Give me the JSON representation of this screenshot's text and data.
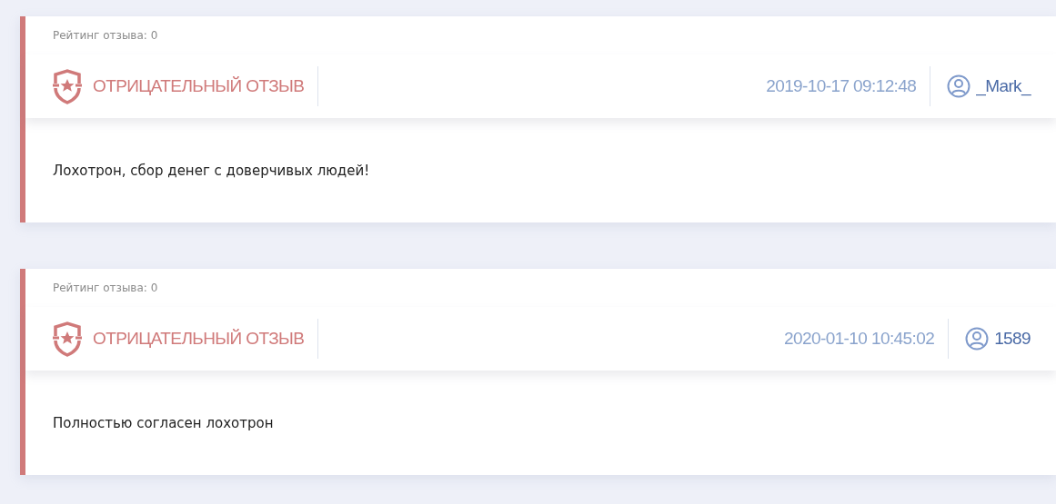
{
  "reviews": [
    {
      "rating_label": "Рейтинг отзыва: 0",
      "kind": "negative",
      "type_label": "ОТРИЦАТЕЛЬНЫЙ ОТЗЫВ",
      "date": "2019-10-17 09:12:48",
      "author": "_Mark_",
      "text": "Лохотрон, сбор денег с доверчивых людей!"
    },
    {
      "rating_label": "Рейтинг отзыва: 0",
      "kind": "negative",
      "type_label": "ОТРИЦАТЕЛЬНЫЙ ОТЗЫВ",
      "date": "2020-01-10 10:45:02",
      "author": "1589",
      "text": "Полностью согласен лохотрон"
    }
  ]
}
